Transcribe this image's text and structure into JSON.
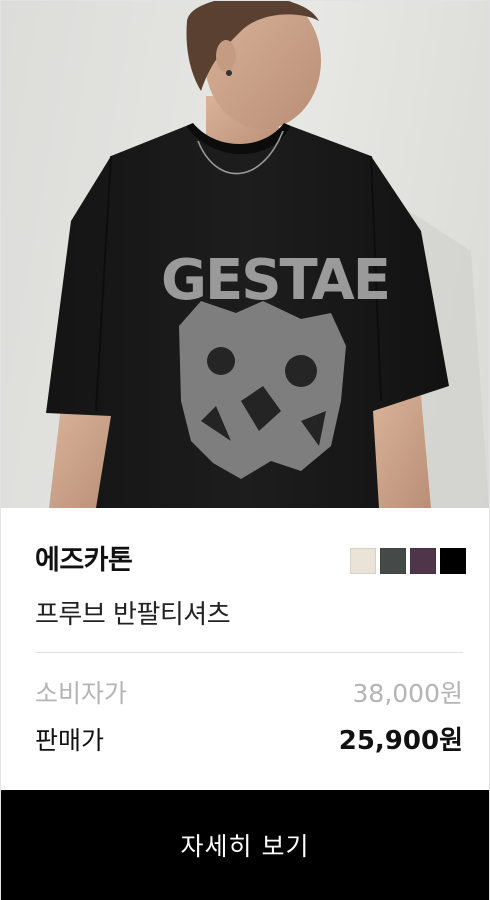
{
  "product": {
    "brand": "에즈카톤",
    "name": "프루브 반팔티셔츠",
    "print_text": "GESTAE",
    "colors": [
      {
        "name": "ivory",
        "hex": "#e9e3d8"
      },
      {
        "name": "charcoal",
        "hex": "#454a48"
      },
      {
        "name": "purple",
        "hex": "#4e3549"
      },
      {
        "name": "black",
        "hex": "#000000"
      }
    ]
  },
  "pricing": {
    "msrp_label": "소비자가",
    "msrp_value": "38,000원",
    "sale_label": "판매가",
    "sale_value": "25,900원"
  },
  "cta": {
    "label": "자세히 보기"
  }
}
